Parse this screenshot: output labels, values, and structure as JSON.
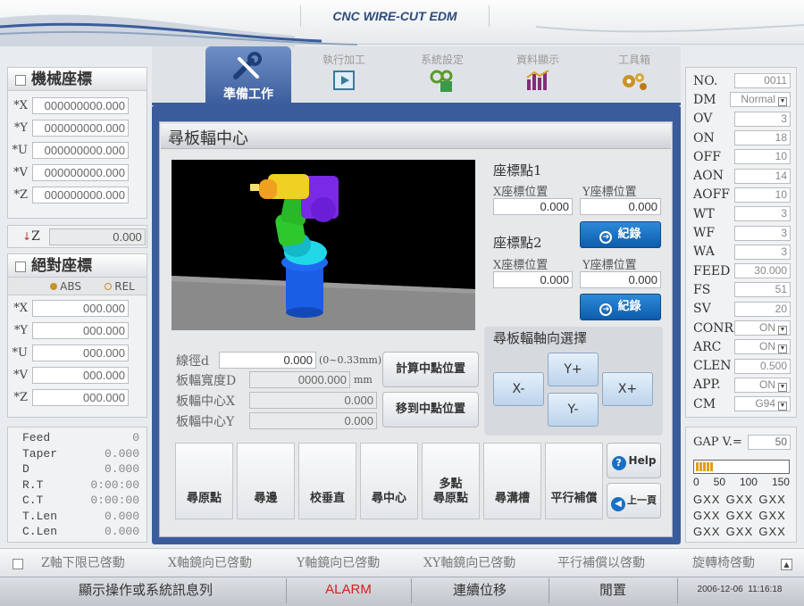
{
  "header": {
    "title": "CNC WIRE-CUT EDM"
  },
  "tabs": [
    {
      "label": "準備工作",
      "active": true,
      "icon": "tools-icon"
    },
    {
      "label": "執行加工",
      "icon": "play-icon"
    },
    {
      "label": "系統設定",
      "icon": "system-settings-icon"
    },
    {
      "label": "資料顯示",
      "icon": "bar-chart-icon"
    },
    {
      "label": "工具箱",
      "icon": "gears-icon"
    }
  ],
  "machine": {
    "title": "機械座標",
    "axes": [
      {
        "label": "X",
        "value": "000000000.000"
      },
      {
        "label": "Y",
        "value": "000000000.000"
      },
      {
        "label": "U",
        "value": "000000000.000"
      },
      {
        "label": "V",
        "value": "000000000.000"
      },
      {
        "label": "Z",
        "value": "000000000.000"
      }
    ],
    "z_limit_label": "Z",
    "z_limit_value": "0.000"
  },
  "absolute": {
    "title": "絕對座標",
    "abs_label": "ABS",
    "rel_label": "REL",
    "axes": [
      {
        "label": "X",
        "value": "000.000"
      },
      {
        "label": "Y",
        "value": "000.000"
      },
      {
        "label": "U",
        "value": "000.000"
      },
      {
        "label": "V",
        "value": "000.000"
      },
      {
        "label": "Z",
        "value": "000.000"
      }
    ]
  },
  "info": [
    {
      "label": "Feed",
      "value": "0"
    },
    {
      "label": "Taper",
      "value": "0.000"
    },
    {
      "label": "D",
      "value": "0.000"
    },
    {
      "label": "R.T",
      "value": "0:00:00"
    },
    {
      "label": "C.T",
      "value": "0:00:00"
    },
    {
      "label": "T.Len",
      "value": "0.000"
    },
    {
      "label": "C.Len",
      "value": "0.000"
    }
  ],
  "main": {
    "title": "尋板輻中心",
    "point1": {
      "title": "座標點1",
      "x_label": "X座標位置",
      "y_label": "Y座標位置",
      "x": "0.000",
      "y": "0.000",
      "record": "紀錄"
    },
    "point2": {
      "title": "座標點2",
      "x_label": "X座標位置",
      "y_label": "Y座標位置",
      "x": "0.000",
      "y": "0.000",
      "record": "紀錄"
    },
    "params": [
      {
        "label": "線徑d",
        "value": "0.000",
        "unit": "(0~0.33mm)"
      },
      {
        "label": "板輻寬度D",
        "value": "0000.000",
        "unit": "mm"
      },
      {
        "label": "板輻中心X",
        "value": "0.000",
        "unit": ""
      },
      {
        "label": "板輻中心Y",
        "value": "0.000",
        "unit": ""
      }
    ],
    "calc_button": "計算中點位置",
    "move_button": "移到中點位置",
    "axis_select": {
      "title": "尋板輻軸向選擇",
      "x_minus": "X-",
      "y_plus": "Y+",
      "y_minus": "Y-",
      "x_plus": "X+"
    },
    "functions": [
      "尋原點",
      "尋邊",
      "校垂直",
      "尋中心",
      "多點\n尋原點",
      "尋溝槽",
      "平行補償"
    ],
    "help": "Help",
    "back": "上一頁"
  },
  "params": [
    {
      "label": "NO.",
      "value": "0011"
    },
    {
      "label": "DM",
      "value": "Normal",
      "dropdown": true
    },
    {
      "label": "OV",
      "value": "3"
    },
    {
      "label": "ON",
      "value": "18"
    },
    {
      "label": "OFF",
      "value": "10"
    },
    {
      "label": "AON",
      "value": "14"
    },
    {
      "label": "AOFF",
      "value": "10"
    },
    {
      "label": "WT",
      "value": "3"
    },
    {
      "label": "WF",
      "value": "3"
    },
    {
      "label": "WA",
      "value": "3"
    },
    {
      "label": "FEED",
      "value": "30.000"
    },
    {
      "label": "FS",
      "value": "51"
    },
    {
      "label": "SV",
      "value": "20"
    },
    {
      "label": "CONR",
      "value": "ON",
      "dropdown": true
    },
    {
      "label": "ARC",
      "value": "ON",
      "dropdown": true
    },
    {
      "label": "CLEN",
      "value": "0.500"
    },
    {
      "label": "APP.",
      "value": "ON",
      "dropdown": true
    },
    {
      "label": "CM",
      "value": "G94",
      "dropdown": true
    }
  ],
  "gap": {
    "label": "GAP V.=",
    "value": "50",
    "level": 0.2,
    "scale": [
      "0",
      "50",
      "100",
      "150"
    ],
    "grid": [
      "GXX",
      "GXX",
      "GXX",
      "GXX",
      "GXX",
      "GXX",
      "GXX",
      "GXX",
      "GXX"
    ]
  },
  "status": [
    "Z軸下限已啓動",
    "X軸鏡向已啓動",
    "Y軸鏡向已啓動",
    "XY軸鏡向已啓動",
    "平行補償以啓動",
    "旋轉椅啓動"
  ],
  "bottom": {
    "message": "顯示操作或系統訊息列",
    "alarm": "ALARM",
    "continuous": "連續位移",
    "idle": "閒置",
    "datetime": "2006-12-06  11:16:18"
  },
  "colors": {
    "accent": "#3a5c9c",
    "alarm": "#d22222",
    "button_blue": "#1a6fc4"
  }
}
